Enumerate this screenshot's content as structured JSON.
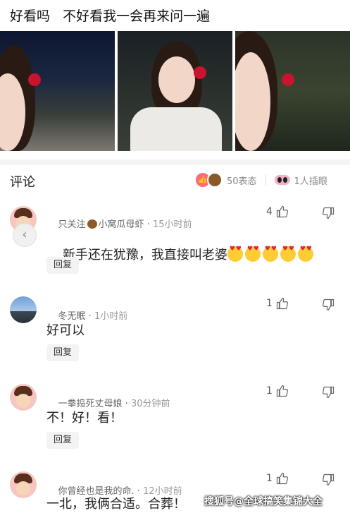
{
  "post": {
    "text": "好看吗   不好看我一会再来问一遍"
  },
  "comments_section": {
    "title": "评论",
    "reaction_count": "50表态",
    "cut_in_count": "1人插眼"
  },
  "comments": [
    {
      "username_prefix": "只关注",
      "username_suffix": "小窝瓜母虾",
      "time": "15小时前",
      "text": "新手还在犹豫，我直接叫老婆",
      "likes": "4",
      "reply_label": "回复"
    },
    {
      "username": "冬无眠",
      "time": "1小时前",
      "text": "好可以",
      "likes": "1",
      "reply_label": "回复"
    },
    {
      "username": "一拳捣死丈母娘",
      "time": "30分钟前",
      "text": "不！好！看！",
      "likes": "1",
      "reply_label": "回复"
    },
    {
      "username": "你曾经也是我的命.",
      "time": "12小时前",
      "text": "一北，我俩合适。合葬！",
      "likes": "1"
    }
  ],
  "watermark": "搜狐号@全球搞笑集锦大全",
  "icons": {
    "like": "thumb-up-icon",
    "dislike": "thumb-down-icon",
    "back": "chevron-left-icon"
  }
}
